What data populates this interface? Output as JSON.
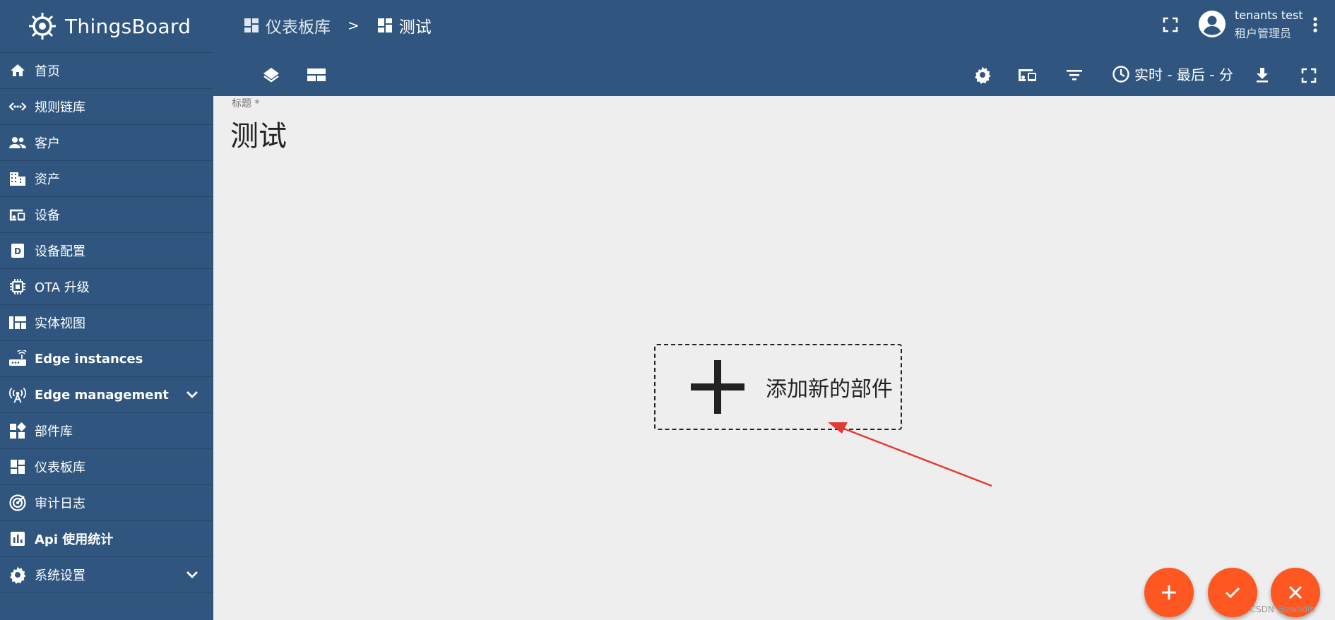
{
  "app": {
    "name": "ThingsBoard"
  },
  "sidebar": {
    "items": [
      {
        "label": "首页",
        "icon": "home-icon"
      },
      {
        "label": "规则链库",
        "icon": "rule-chain-icon"
      },
      {
        "label": "客户",
        "icon": "customers-icon"
      },
      {
        "label": "资产",
        "icon": "assets-icon"
      },
      {
        "label": "设备",
        "icon": "devices-icon"
      },
      {
        "label": "设备配置",
        "icon": "device-profile-icon"
      },
      {
        "label": "OTA 升级",
        "icon": "chip-icon"
      },
      {
        "label": "实体视图",
        "icon": "entity-view-icon"
      },
      {
        "label": "Edge instances",
        "icon": "router-icon"
      },
      {
        "label": "Edge management",
        "icon": "antenna-icon",
        "expandable": true
      },
      {
        "label": "部件库",
        "icon": "widgets-icon"
      },
      {
        "label": "仪表板库",
        "icon": "dashboard-icon"
      },
      {
        "label": "审计日志",
        "icon": "track-changes-icon"
      },
      {
        "label": "Api 使用统计",
        "icon": "insert-chart-icon"
      },
      {
        "label": "系统设置",
        "icon": "settings-icon",
        "expandable": true
      }
    ]
  },
  "breadcrumb": {
    "parent": "仪表板库",
    "separator": ">",
    "current": "测试"
  },
  "user": {
    "name": "tenants test",
    "role": "租户管理员"
  },
  "toolbar": {
    "time_window": "实时 - 最后 - 分"
  },
  "dashboard": {
    "title_label": "标题 *",
    "title_value": "测试",
    "add_widget_label": "添加新的部件"
  },
  "colors": {
    "primary": "#305680",
    "accent": "#ff5722",
    "annotation_arrow": "#e53935",
    "background": "#eeeeee"
  },
  "watermark": "CSDN @zwhdlb"
}
